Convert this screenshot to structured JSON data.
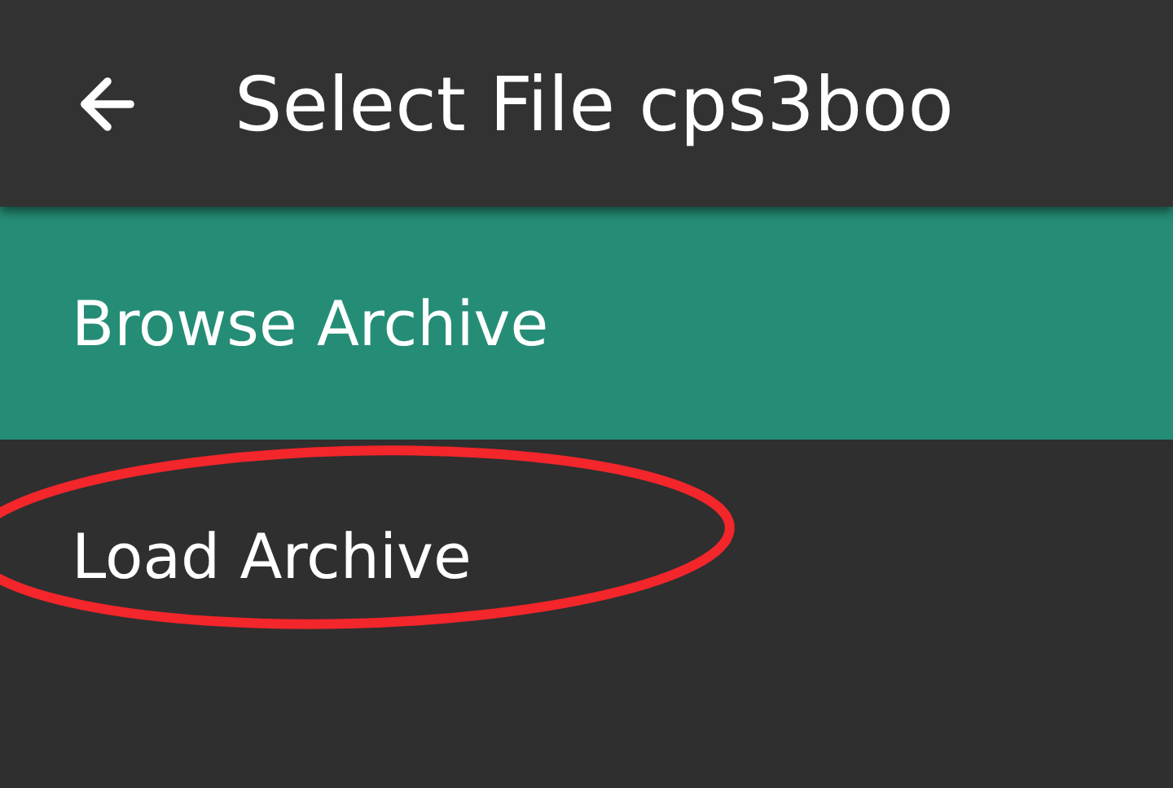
{
  "app_bar": {
    "title": "Select File cps3boo"
  },
  "menu_items": [
    {
      "label": "Browse Archive",
      "selected": true,
      "circled": false
    },
    {
      "label": "Load Archive",
      "selected": false,
      "circled": true
    }
  ]
}
